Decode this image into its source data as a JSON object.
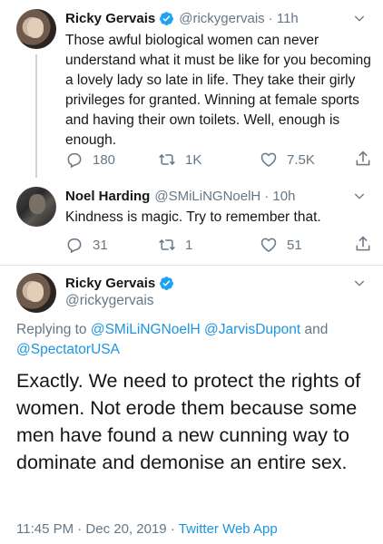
{
  "tweets": [
    {
      "name": "Ricky Gervais",
      "handle": "@rickygervais",
      "time": "· 11h",
      "verified": true,
      "text": "Those awful biological women can never understand what it must be like for you becoming a lovely lady so late in life. They take their girly privileges for granted. Winning at female sports and having their own toilets. Well, enough is enough.",
      "replies": "180",
      "retweets": "1K",
      "likes": "7.5K"
    },
    {
      "name": "Noel Harding",
      "handle": "@SMiLiNGNoelH",
      "time": "· 10h",
      "verified": false,
      "text": "Kindness is magic. Try to remember that.",
      "replies": "31",
      "retweets": "1",
      "likes": "51"
    }
  ],
  "main_tweet": {
    "name": "Ricky Gervais",
    "handle": "@rickygervais",
    "verified": true,
    "replying_prefix": "Replying to",
    "replying_to": [
      "@SMiLiNGNoelH",
      "@JarvisDupont",
      "@SpectatorUSA"
    ],
    "replying_and": "and",
    "text": "Exactly. We need to protect the rights of women. Not erode them because some men have found a new cunning way to dominate and demonise an entire sex.",
    "timestamp": "11:45 PM · Dec 20, 2019 ·",
    "source": "Twitter Web App"
  },
  "colors": {
    "accent": "#1b95e0",
    "secondary_text": "#657786",
    "primary_text": "#14171a",
    "separator": "#e1e8ed"
  },
  "icons": [
    "reply-icon",
    "retweet-icon",
    "like-icon",
    "share-icon",
    "chevron-down-icon",
    "verified-badge-icon"
  ]
}
